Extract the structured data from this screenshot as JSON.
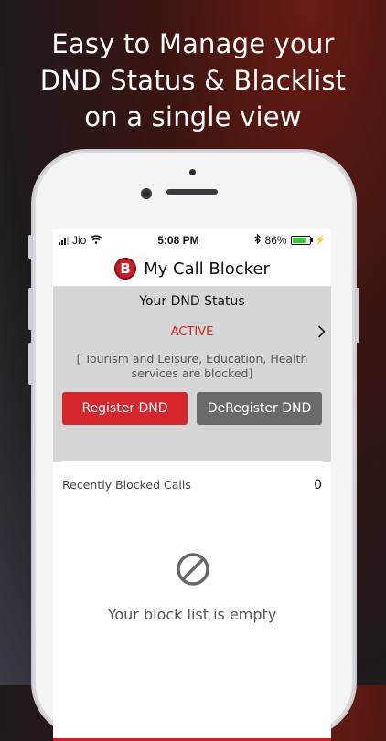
{
  "headline": {
    "line1": "Easy to Manage your",
    "line2": "DND Status & Blacklist",
    "line3": "on a single view"
  },
  "status_bar": {
    "carrier": "Jio",
    "time": "5:08 PM",
    "battery_percent": "86%",
    "battery_level": 0.86
  },
  "app": {
    "logo_letter": "B",
    "title": "My Call Blocker"
  },
  "dnd": {
    "title": "Your DND Status",
    "status": "ACTIVE",
    "description": "[ Tourism and Leisure, Education,  Health services are blocked]",
    "register_label": "Register DND",
    "deregister_label": "DeRegister DND"
  },
  "blocked": {
    "header": "Recently Blocked Calls",
    "count": "0",
    "empty_message": "Your block list is empty"
  },
  "colors": {
    "accent_red": "#d4262c",
    "secondary_gray": "#6a6a6a",
    "panel_gray": "#d6d6d6"
  }
}
